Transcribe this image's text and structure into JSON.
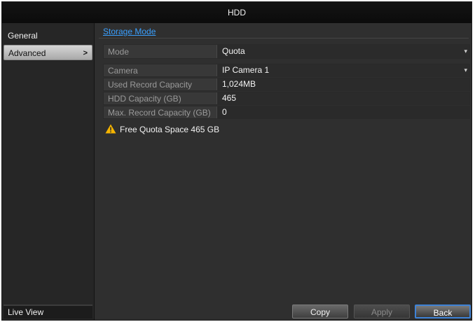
{
  "window": {
    "title": "HDD"
  },
  "sidebar": {
    "items": [
      {
        "label": "General"
      },
      {
        "label": "Advanced",
        "chevron": ">"
      }
    ],
    "live_view": "Live View"
  },
  "tabs": [
    {
      "label": "Storage Mode",
      "active": true
    }
  ],
  "form": {
    "mode": {
      "label": "Mode",
      "value": "Quota"
    },
    "camera": {
      "label": "Camera",
      "value": "IP Camera 1"
    },
    "used_record_capacity": {
      "label": "Used Record Capacity",
      "value": "1,024MB"
    },
    "hdd_capacity": {
      "label": "HDD Capacity (GB)",
      "value": "465"
    },
    "max_record_capacity": {
      "label": "Max. Record Capacity (GB)",
      "value": "0"
    }
  },
  "message": {
    "icon": "warning-icon",
    "text": "Free Quota Space 465 GB"
  },
  "buttons": {
    "copy": "Copy",
    "apply": "Apply",
    "back": "Back"
  },
  "colors": {
    "accent": "#3aa0ff",
    "warning": "#f5b400",
    "background": "#2f2f2f"
  }
}
